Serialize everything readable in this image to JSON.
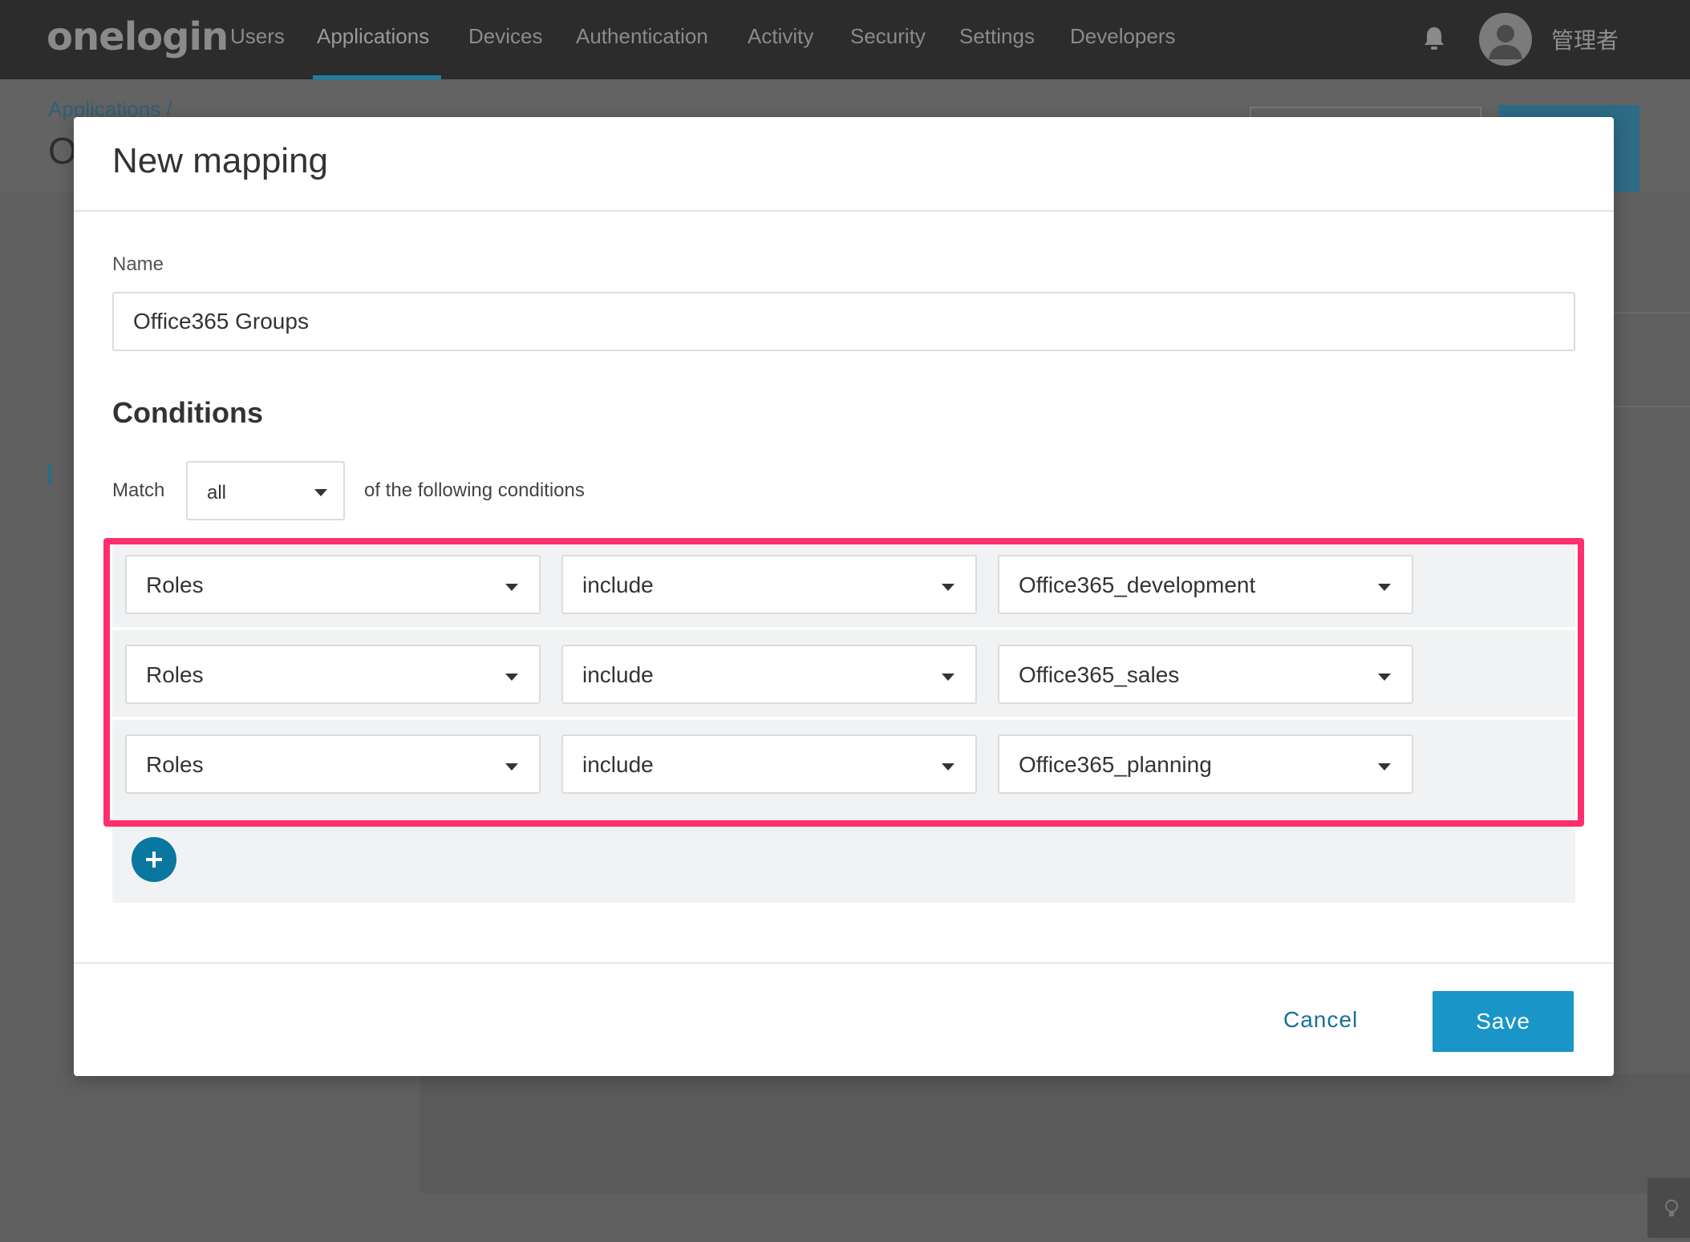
{
  "nav": {
    "logo": "onelogin",
    "items": [
      "Users",
      "Applications",
      "Devices",
      "Authentication",
      "Activity",
      "Security",
      "Settings",
      "Developers"
    ],
    "active": "Applications",
    "username": "管理者"
  },
  "background": {
    "breadcrumb": "Applications /",
    "title_fragment": "O"
  },
  "modal": {
    "title": "New mapping",
    "name_label": "Name",
    "name_value": "Office365 Groups",
    "conditions_heading": "Conditions",
    "match_label": "Match",
    "match_value": "all",
    "following_label": "of the following conditions",
    "conditions": [
      {
        "field": "Roles",
        "operator": "include",
        "value": "Office365_development"
      },
      {
        "field": "Roles",
        "operator": "include",
        "value": "Office365_sales"
      },
      {
        "field": "Roles",
        "operator": "include",
        "value": "Office365_planning"
      }
    ],
    "cancel_label": "Cancel",
    "save_label": "Save"
  },
  "colors": {
    "highlight": "#ff2f6e",
    "primary": "#1a95c8",
    "add_button": "#0a77a0"
  }
}
